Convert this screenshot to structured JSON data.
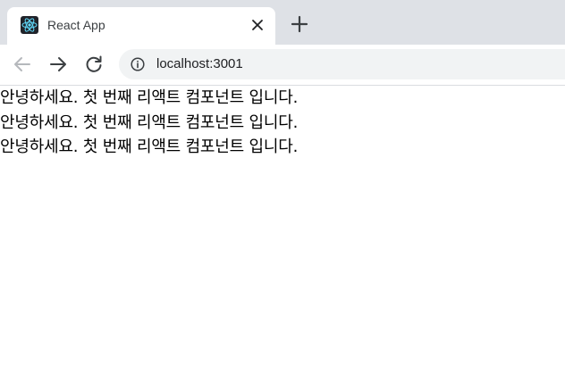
{
  "browser": {
    "tab": {
      "title": "React App",
      "favicon": "react-logo-icon"
    },
    "new_tab": "plus-icon",
    "toolbar": {
      "back": "arrow-left-icon",
      "forward": "arrow-right-icon",
      "reload": "reload-icon",
      "site_info": "info-icon",
      "url": "localhost:3001"
    },
    "colors": {
      "tabstrip": "#dee1e6",
      "omnibox": "#f1f3f4",
      "react_blue": "#61dafb"
    }
  },
  "page": {
    "lines": [
      "안녕하세요. 첫 번째 리액트 컴포넌트 입니다.",
      "안녕하세요. 첫 번째 리액트 컴포넌트 입니다.",
      "안녕하세요. 첫 번째 리액트 컴포넌트 입니다."
    ]
  }
}
